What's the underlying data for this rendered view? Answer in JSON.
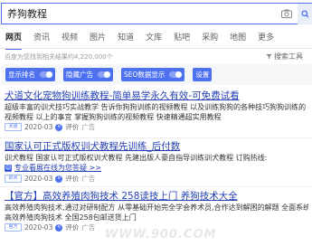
{
  "search": {
    "query": "养狗教程"
  },
  "tabs": [
    "网页",
    "资讯",
    "视频",
    "图片",
    "知道",
    "文库",
    "贴吧",
    "采购",
    "地图",
    "更多"
  ],
  "tools": {
    "stats": "百度为您找到相关结果约4,220,000个",
    "search_tools_label": "搜索工具"
  },
  "toggles": [
    "显示排名",
    "隐藏广告",
    "SEO数据显示",
    "设置"
  ],
  "results": [
    {
      "title": "犬道文化宠物狗训练教程-简单易学永久有效-可免费试看",
      "desc1": "超级丰富的训犬技巧实战教学 告诉你狗狗训练的视频教程 以及训练狗狗的各种技巧狗狗训练的",
      "desc2": "视频教程 以上的事宜 掌握狗狗训练的视频教程 快速精通超实用教程",
      "logo": "犬道",
      "date": "2020-03",
      "rating": "评价",
      "ad": "广告"
    },
    {
      "title": "国家认可正式版权训犬教程先训练_后付数",
      "desc1": "训犬教程 国家认可正式版权训犬教程 先建出版人豪自指导训练训犬教程 订购热线:",
      "link": "专业看展在线为您答疑 >>",
      "logo": "训犬",
      "date": "2020-03",
      "rating": "评价",
      "ad": "广告"
    },
    {
      "title": "【官方】高效养殖肉狗技术 258读技上门 养狗技术大全",
      "desc1": "高效养殖肉狗技术,通过对研制配方 从零基础开始完全学会养术员,合作达到解困的解题 全面系统的",
      "desc2": "高效养殖肉狗技术 全国258包邮送货上门",
      "logo": "官方",
      "date": "2020-03",
      "rating": "评价",
      "ad": "广告"
    }
  ],
  "watermark": "WWW.900.COM"
}
